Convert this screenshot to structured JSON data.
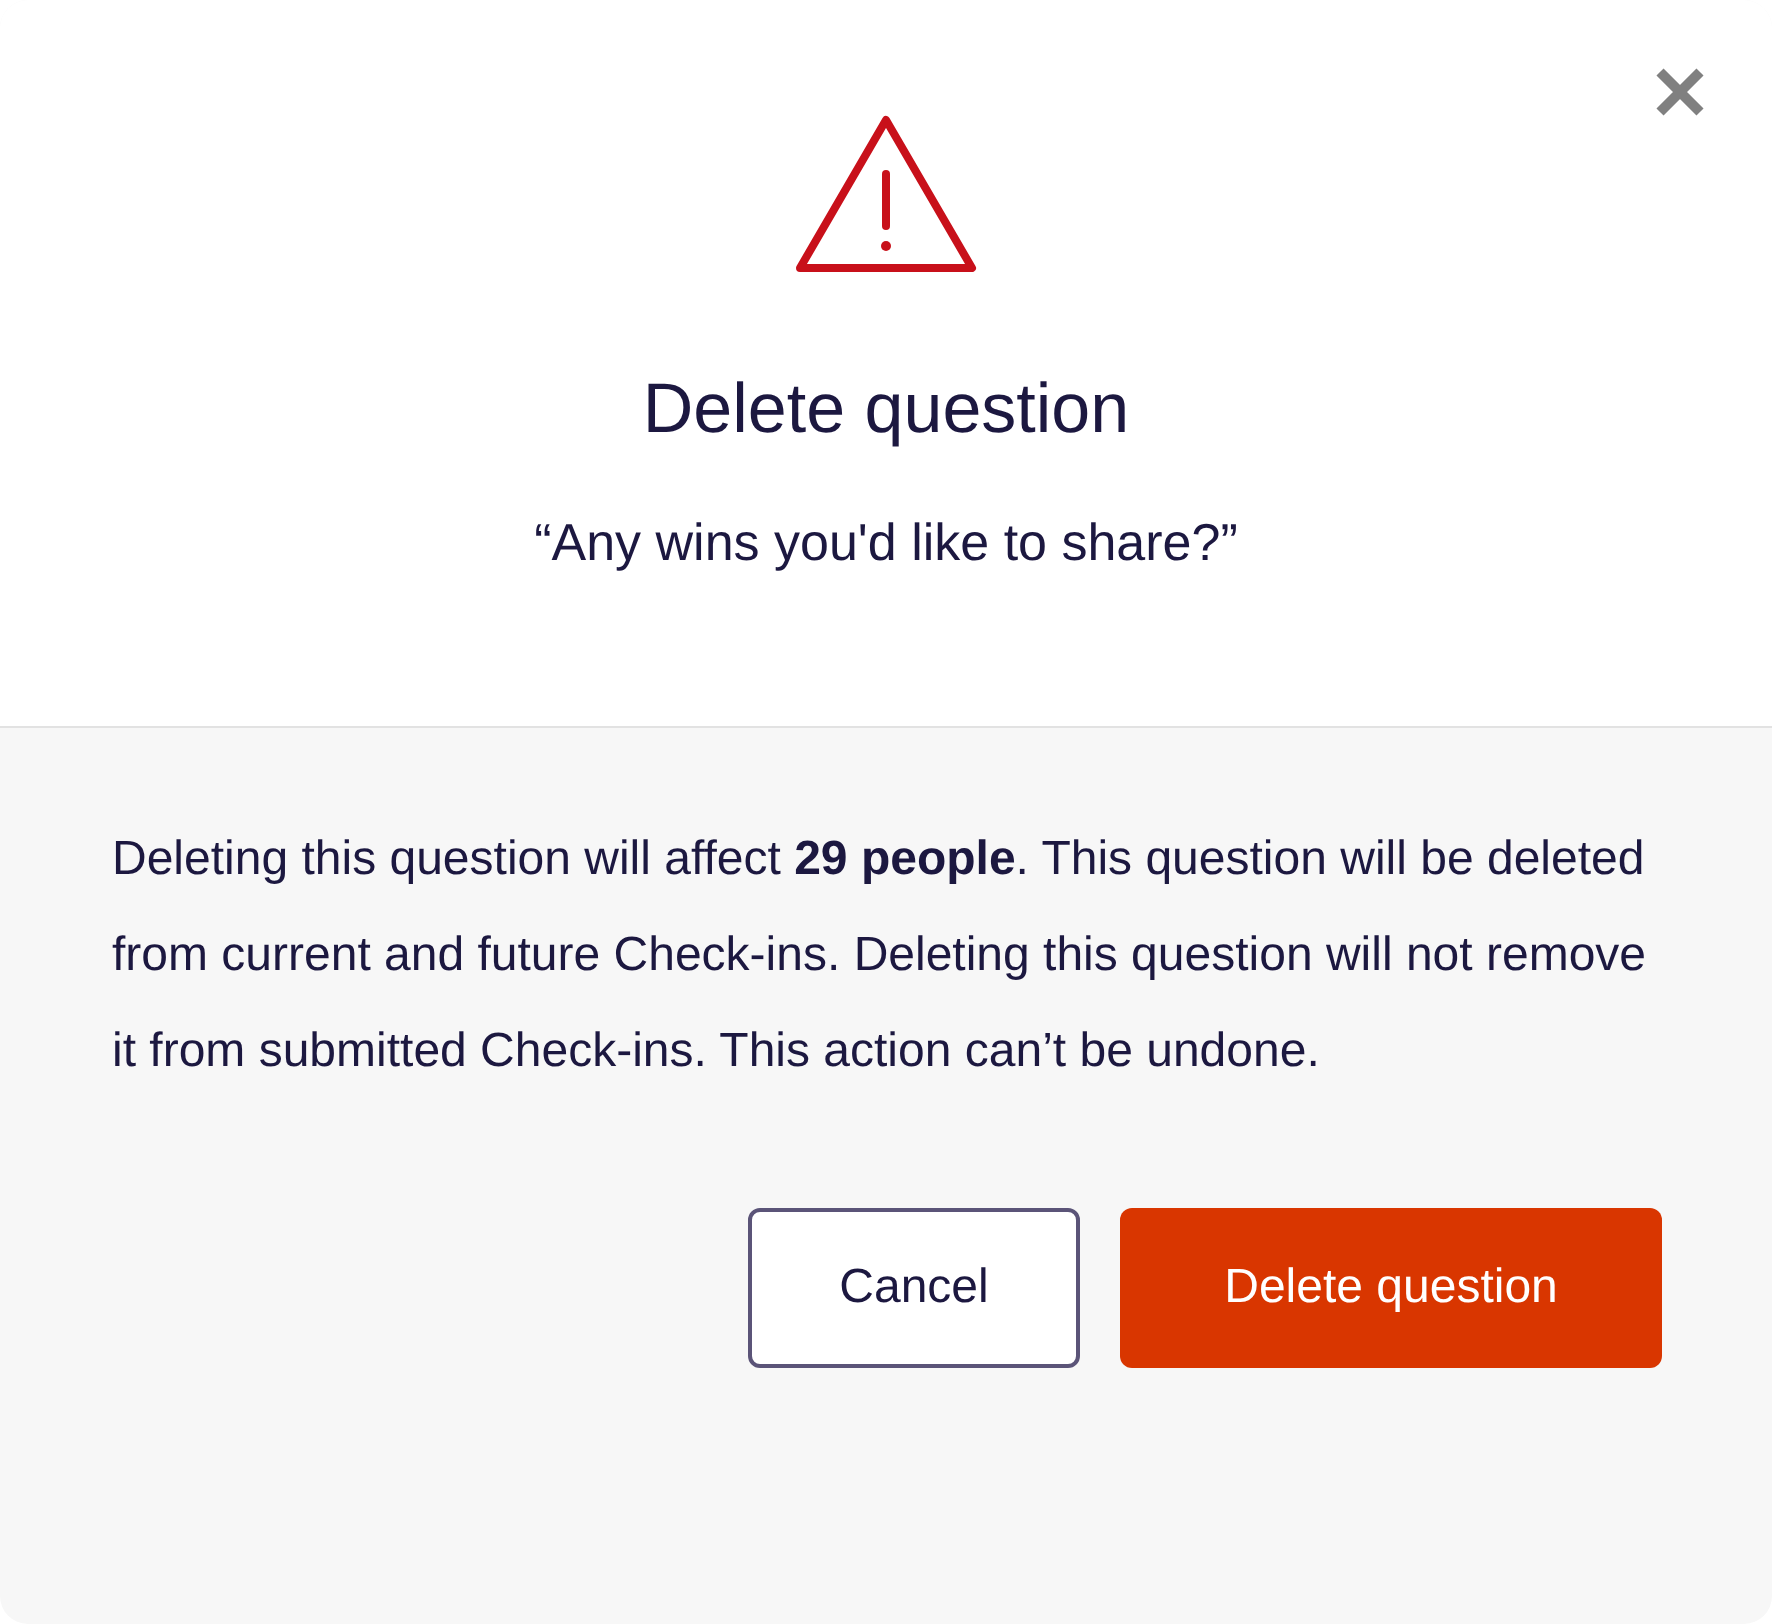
{
  "dialog": {
    "title": "Delete question",
    "question": "“Any wins you'd like to share?”",
    "message": "Deleting this question will affect **29 people**. This question will be deleted from current and future Check-ins. Deleting this question will not remove it from submitted Check-ins. This action can’t be undone.",
    "buttons": [
      {
        "label": "Cancel",
        "kind": "secondary"
      },
      {
        "label": "Delete question",
        "kind": "primary"
      }
    ]
  }
}
